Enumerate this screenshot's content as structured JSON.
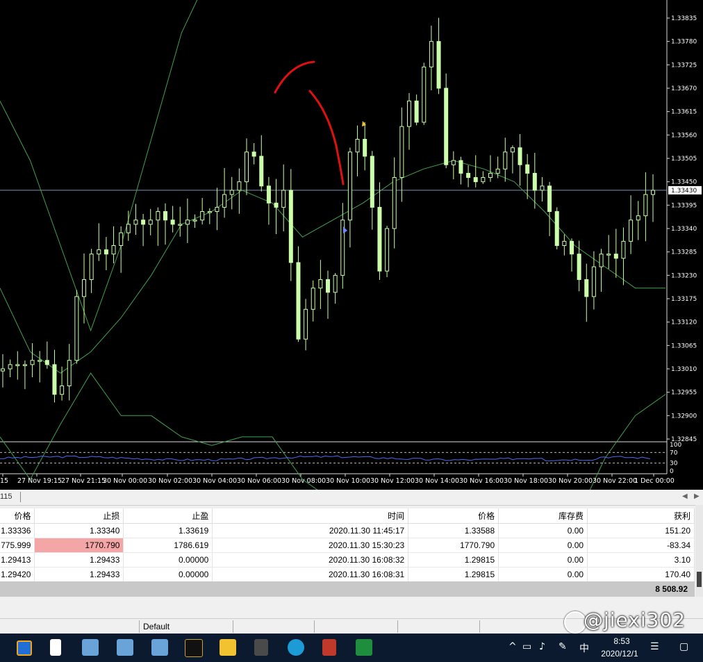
{
  "chart_data": {
    "type": "candlestick",
    "price_axis": [
      "1.33835",
      "1.33780",
      "1.33725",
      "1.33670",
      "1.33615",
      "1.33560",
      "1.33505",
      "1.33450",
      "1.33395",
      "1.33340",
      "1.33285",
      "1.33230",
      "1.33175",
      "1.33120",
      "1.33065",
      "1.33010",
      "1.32955",
      "1.32900",
      "1.32845"
    ],
    "current_price": "1.33430",
    "ylim": [
      1.32845,
      1.33835
    ],
    "time_axis": [
      "15",
      "27 Nov 19:15",
      "27 Nov 21:15",
      "30 Nov 00:00",
      "30 Nov 02:00",
      "30 Nov 04:00",
      "30 Nov 06:00",
      "30 Nov 08:00",
      "30 Nov 10:00",
      "30 Nov 12:00",
      "30 Nov 14:00",
      "30 Nov 16:00",
      "30 Nov 18:00",
      "30 Nov 20:00",
      "30 Nov 22:00",
      "1 Dec 00:00"
    ],
    "close_path": [
      1.3301,
      1.3302,
      1.3302,
      1.3302,
      1.3303,
      1.3303,
      1.3302,
      1.3295,
      1.3297,
      1.3303,
      1.3318,
      1.3322,
      1.3328,
      1.3329,
      1.3328,
      1.333,
      1.3333,
      1.3335,
      1.3336,
      1.3335,
      1.3336,
      1.3338,
      1.3336,
      1.3335,
      1.3335,
      1.3336,
      1.3336,
      1.3338,
      1.3338,
      1.3339,
      1.3342,
      1.3343,
      1.3345,
      1.3352,
      1.3351,
      1.3344,
      1.334,
      1.3339,
      1.3343,
      1.3326,
      1.3308,
      1.3315,
      1.332,
      1.3322,
      1.3319,
      1.3323,
      1.3336,
      1.3352,
      1.3355,
      1.3351,
      1.3339,
      1.3324,
      1.3334,
      1.3346,
      1.3358,
      1.3364,
      1.3359,
      1.3372,
      1.3378,
      1.3367,
      1.3349,
      1.335,
      1.3347,
      1.3346,
      1.3345,
      1.3346,
      1.3347,
      1.3348,
      1.3352,
      1.3353,
      1.3349,
      1.3347,
      1.3343,
      1.3344,
      1.3338,
      1.333,
      1.3331,
      1.3328,
      1.3322,
      1.3318,
      1.3325,
      1.3328,
      1.3328,
      1.3327,
      1.3331,
      1.3336,
      1.3337,
      1.3342,
      1.3343
    ],
    "bb_upper": [
      1.3364,
      1.335,
      1.333,
      1.331,
      1.333,
      1.3355,
      1.338,
      1.3395,
      1.34,
      1.3395,
      1.34,
      1.341,
      1.342,
      1.343,
      1.344,
      1.344,
      1.345,
      1.3455,
      1.346,
      1.3463,
      1.3463,
      1.3455,
      1.344
    ],
    "bb_middle": [
      1.332,
      1.3305,
      1.33,
      1.3305,
      1.3313,
      1.3323,
      1.3335,
      1.3338,
      1.3343,
      1.334,
      1.3332,
      1.3336,
      1.334,
      1.3345,
      1.3348,
      1.335,
      1.3348,
      1.3345,
      1.3338,
      1.333,
      1.3325,
      1.332,
      1.332
    ],
    "bb_lower": [
      1.3285,
      1.3275,
      1.3288,
      1.33,
      1.329,
      1.329,
      1.3285,
      1.3283,
      1.3285,
      1.3285,
      1.3275,
      1.327,
      1.3258,
      1.3258,
      1.3252,
      1.325,
      1.3245,
      1.3245,
      1.325,
      1.3265,
      1.328,
      1.329,
      1.3295
    ],
    "indicator_axis": [
      "100",
      "70",
      "30",
      "0"
    ],
    "indicator_levels": [
      70,
      30
    ]
  },
  "colors": {
    "candle": "#ccffaa",
    "bollinger": "#3fa34d",
    "annotation": "#e01010",
    "indicator_line": "#4a6cf0",
    "current_price_line": "#7c8fb5"
  },
  "terminal": {
    "tab_partial": "115",
    "columns": [
      "价格",
      "止损",
      "止盈",
      "时间",
      "价格",
      "库存费",
      "获利"
    ],
    "rows": [
      [
        "1.33336",
        "1.33340",
        "1.33619",
        "2020.11.30 11:45:17",
        "1.33588",
        "0.00",
        "151.20"
      ],
      [
        "775.999",
        "1770.790",
        "1786.619",
        "2020.11.30 15:30:23",
        "1770.790",
        "0.00",
        "-83.34"
      ],
      [
        "1.29413",
        "1.29433",
        "0.00000",
        "2020.11.30 16:08:32",
        "1.29815",
        "0.00",
        "3.10"
      ],
      [
        "1.29420",
        "1.29433",
        "0.00000",
        "2020.11.30 16:08:31",
        "1.29815",
        "0.00",
        "170.40"
      ]
    ],
    "total": "8 508.92"
  },
  "status_bar": {
    "profile": "Default"
  },
  "watermark": {
    "text": "@jiexi302"
  },
  "taskbar": {
    "time": "8:53",
    "date": "2020/12/1",
    "ime": "中",
    "icons": [
      "window-icon",
      "file-icon",
      "remote-icon",
      "remote-icon",
      "remote-icon",
      "trading-app-icon",
      "folder-icon",
      "calculator-icon",
      "edge-icon",
      "tool-icon",
      "excel-icon"
    ]
  }
}
